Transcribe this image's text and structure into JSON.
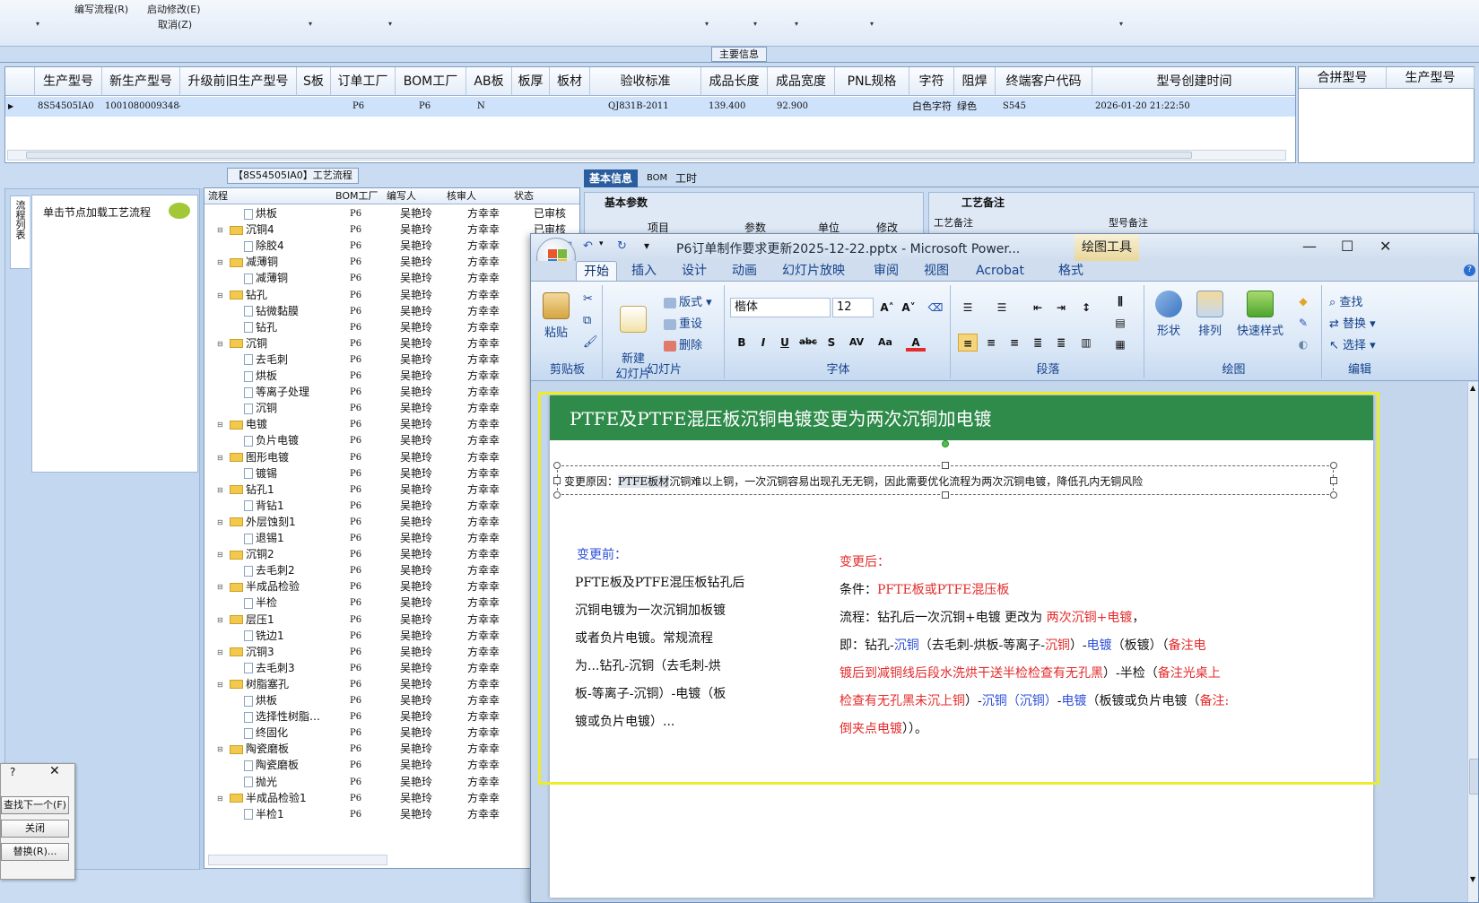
{
  "topmenu": {
    "items": [
      "编写流程(R)",
      "启动修改(E)",
      "取消(Z)"
    ]
  },
  "main": {
    "title": "主要信息",
    "columns": [
      "生产型号",
      "新生产型号",
      "升级前旧生产型号",
      "S板",
      "订单工厂",
      "BOM工厂",
      "AB板",
      "板厚",
      "板材",
      "验收标准",
      "成品长度",
      "成品宽度",
      "PNL规格",
      "字符",
      "阻焊",
      "终端客户代码",
      "型号创建时间"
    ],
    "row": [
      "8S54505IA0",
      "10010800093484",
      "",
      "",
      "P6",
      "P6",
      "N",
      "",
      "",
      "QJ831B-2011",
      "139.400",
      "92.900",
      "",
      "白色字符",
      "绿色",
      "S545",
      "2026-01-20 21:22:50"
    ],
    "right_columns": [
      "合拼型号",
      "生产型号"
    ]
  },
  "left": {
    "tab_label": "流程列表",
    "node_hint": "单击节点加载工艺流程"
  },
  "process": {
    "title": "【8S54505IA0】工艺流程",
    "columns": [
      "流程",
      "BOM工厂",
      "编写人",
      "核审人",
      "状态"
    ],
    "rows": [
      {
        "name": "烘板",
        "level": 2,
        "bom": "P6",
        "writer": "吴艳玲",
        "checker": "方幸幸",
        "status": "已审核"
      },
      {
        "name": "沉铜4",
        "level": 1,
        "bom": "P6",
        "writer": "吴艳玲",
        "checker": "方幸幸",
        "status": "已审核"
      },
      {
        "name": "除胶4",
        "level": 2,
        "bom": "P6",
        "writer": "吴艳玲",
        "checker": "方幸幸",
        "status": ""
      },
      {
        "name": "减薄铜",
        "level": 1,
        "bom": "P6",
        "writer": "吴艳玲",
        "checker": "方幸幸",
        "status": ""
      },
      {
        "name": "减薄铜",
        "level": 2,
        "bom": "P6",
        "writer": "吴艳玲",
        "checker": "方幸幸",
        "status": ""
      },
      {
        "name": "钻孔",
        "level": 1,
        "bom": "P6",
        "writer": "吴艳玲",
        "checker": "方幸幸",
        "status": ""
      },
      {
        "name": "钻微黏膜",
        "level": 2,
        "bom": "P6",
        "writer": "吴艳玲",
        "checker": "方幸幸",
        "status": ""
      },
      {
        "name": "钻孔",
        "level": 2,
        "bom": "P6",
        "writer": "吴艳玲",
        "checker": "方幸幸",
        "status": ""
      },
      {
        "name": "沉铜",
        "level": 1,
        "bom": "P6",
        "writer": "吴艳玲",
        "checker": "方幸幸",
        "status": ""
      },
      {
        "name": "去毛刺",
        "level": 2,
        "bom": "P6",
        "writer": "吴艳玲",
        "checker": "方幸幸",
        "status": ""
      },
      {
        "name": "烘板",
        "level": 2,
        "bom": "P6",
        "writer": "吴艳玲",
        "checker": "方幸幸",
        "status": ""
      },
      {
        "name": "等离子处理",
        "level": 2,
        "bom": "P6",
        "writer": "吴艳玲",
        "checker": "方幸幸",
        "status": ""
      },
      {
        "name": "沉铜",
        "level": 2,
        "bom": "P6",
        "writer": "吴艳玲",
        "checker": "方幸幸",
        "status": ""
      },
      {
        "name": "电镀",
        "level": 1,
        "bom": "P6",
        "writer": "吴艳玲",
        "checker": "方幸幸",
        "status": ""
      },
      {
        "name": "负片电镀",
        "level": 2,
        "bom": "P6",
        "writer": "吴艳玲",
        "checker": "方幸幸",
        "status": ""
      },
      {
        "name": "图形电镀",
        "level": 1,
        "bom": "P6",
        "writer": "吴艳玲",
        "checker": "方幸幸",
        "status": ""
      },
      {
        "name": "镀锡",
        "level": 2,
        "bom": "P6",
        "writer": "吴艳玲",
        "checker": "方幸幸",
        "status": ""
      },
      {
        "name": "钻孔1",
        "level": 1,
        "bom": "P6",
        "writer": "吴艳玲",
        "checker": "方幸幸",
        "status": ""
      },
      {
        "name": "背钻1",
        "level": 2,
        "bom": "P6",
        "writer": "吴艳玲",
        "checker": "方幸幸",
        "status": ""
      },
      {
        "name": "外层蚀刻1",
        "level": 1,
        "bom": "P6",
        "writer": "吴艳玲",
        "checker": "方幸幸",
        "status": ""
      },
      {
        "name": "退锡1",
        "level": 2,
        "bom": "P6",
        "writer": "吴艳玲",
        "checker": "方幸幸",
        "status": ""
      },
      {
        "name": "沉铜2",
        "level": 1,
        "bom": "P6",
        "writer": "吴艳玲",
        "checker": "方幸幸",
        "status": ""
      },
      {
        "name": "去毛刺2",
        "level": 2,
        "bom": "P6",
        "writer": "吴艳玲",
        "checker": "方幸幸",
        "status": ""
      },
      {
        "name": "半成品检验",
        "level": 1,
        "bom": "P6",
        "writer": "吴艳玲",
        "checker": "方幸幸",
        "status": ""
      },
      {
        "name": "半检",
        "level": 2,
        "bom": "P6",
        "writer": "吴艳玲",
        "checker": "方幸幸",
        "status": ""
      },
      {
        "name": "层压1",
        "level": 1,
        "bom": "P6",
        "writer": "吴艳玲",
        "checker": "方幸幸",
        "status": ""
      },
      {
        "name": "铣边1",
        "level": 2,
        "bom": "P6",
        "writer": "吴艳玲",
        "checker": "方幸幸",
        "status": ""
      },
      {
        "name": "沉铜3",
        "level": 1,
        "bom": "P6",
        "writer": "吴艳玲",
        "checker": "方幸幸",
        "status": ""
      },
      {
        "name": "去毛刺3",
        "level": 2,
        "bom": "P6",
        "writer": "吴艳玲",
        "checker": "方幸幸",
        "status": ""
      },
      {
        "name": "树脂塞孔",
        "level": 1,
        "bom": "P6",
        "writer": "吴艳玲",
        "checker": "方幸幸",
        "status": ""
      },
      {
        "name": "烘板",
        "level": 2,
        "bom": "P6",
        "writer": "吴艳玲",
        "checker": "方幸幸",
        "status": ""
      },
      {
        "name": "选择性树脂…",
        "level": 2,
        "bom": "P6",
        "writer": "吴艳玲",
        "checker": "方幸幸",
        "status": ""
      },
      {
        "name": "终固化",
        "level": 2,
        "bom": "P6",
        "writer": "吴艳玲",
        "checker": "方幸幸",
        "status": ""
      },
      {
        "name": "陶瓷磨板",
        "level": 1,
        "bom": "P6",
        "writer": "吴艳玲",
        "checker": "方幸幸",
        "status": ""
      },
      {
        "name": "陶瓷磨板",
        "level": 2,
        "bom": "P6",
        "writer": "吴艳玲",
        "checker": "方幸幸",
        "status": ""
      },
      {
        "name": "抛光",
        "level": 2,
        "bom": "P6",
        "writer": "吴艳玲",
        "checker": "方幸幸",
        "status": ""
      },
      {
        "name": "半成品检验1",
        "level": 1,
        "bom": "P6",
        "writer": "吴艳玲",
        "checker": "方幸幸",
        "status": ""
      },
      {
        "name": "半检1",
        "level": 2,
        "bom": "P6",
        "writer": "吴艳玲",
        "checker": "方幸幸",
        "status": ""
      }
    ]
  },
  "right": {
    "tabs": [
      "基本信息",
      "BOM",
      "工时"
    ],
    "basic_param": "基本参数",
    "basic_cols": [
      "项目",
      "参数",
      "单位",
      "修改"
    ],
    "remark_title": "工艺备注",
    "remark_cols": [
      "工艺备注",
      "型号备注"
    ]
  },
  "find": {
    "title_q": "?",
    "next": "查找下一个(F)",
    "close": "关闭",
    "replace": "替换(R)..."
  },
  "ppt": {
    "title": "P6订单制作要求更新2025-12-22.pptx - Microsoft Power...",
    "context_tab": "绘图工具",
    "tabs": [
      "开始",
      "插入",
      "设计",
      "动画",
      "幻灯片放映",
      "审阅",
      "视图",
      "Acrobat",
      "格式"
    ],
    "ribbon": {
      "paste": "粘贴",
      "clipboard": "剪贴板",
      "new_slide": "新建\n幻灯片",
      "layout": "版式",
      "reset": "重设",
      "delete": "删除",
      "slides": "幻灯片",
      "font_name": "楷体",
      "font_size": "12",
      "font": "字体",
      "paragraph": "段落",
      "shape": "形状",
      "arrange": "排列",
      "quick_style": "快速样式",
      "drawing": "绘图",
      "find": "查找",
      "replace": "替换",
      "select": "选择",
      "editing": "编辑"
    },
    "slide": {
      "title": "PTFE及PTFE混压板沉铜电镀变更为两次沉铜加电镀",
      "reason_prefix": "变更原因：",
      "reason_hl": "PTFE板材",
      "reason_rest": "沉铜难以上铜，一次沉铜容易出现孔无无铜，因此需要优化流程为两次沉铜电镀，降低孔内无铜风险",
      "before_title": "变更前：",
      "before_lines": [
        "PFTE板及PTFE混压板钻孔后",
        "沉铜电镀为一次沉铜加板镀",
        "或者负片电镀。常规流程",
        "为...钻孔-沉铜（去毛刺-烘",
        "板-等离子-沉铜）-电镀（板",
        "镀或负片电镀）..."
      ],
      "after_title": "变更后：",
      "after_cond_label": "条件：",
      "after_cond": "PFTE板或PTFE混压板",
      "after_flow_label": "流程：钻孔后一次沉铜+电镀  更改为 ",
      "after_flow": "两次沉铜+电镀",
      "after_flow_end": "，",
      "l3a": "即：钻孔-",
      "l3b": "沉铜",
      "l3c": "（去毛刺-烘板-等离子-",
      "l3d": "沉铜",
      "l3e": "）-",
      "l3f": "电镀",
      "l3g": "（板镀）（",
      "l3h": "备注电",
      "l4": "镀后到减铜线后段水洗烘干送半检检查有无孔黑",
      "l4b": "）-半检（",
      "l4c": "备注光桌上",
      "l5": "检查有无孔黑未沉上铜",
      "l5b": "）-",
      "l5c": "沉铜（沉铜）",
      "l5d": "-",
      "l5e": "电镀",
      "l5f": "（板镀或负片电镀（",
      "l5g": "备注:",
      "l6": "倒夹点电镀",
      "l6b": "））。"
    }
  }
}
